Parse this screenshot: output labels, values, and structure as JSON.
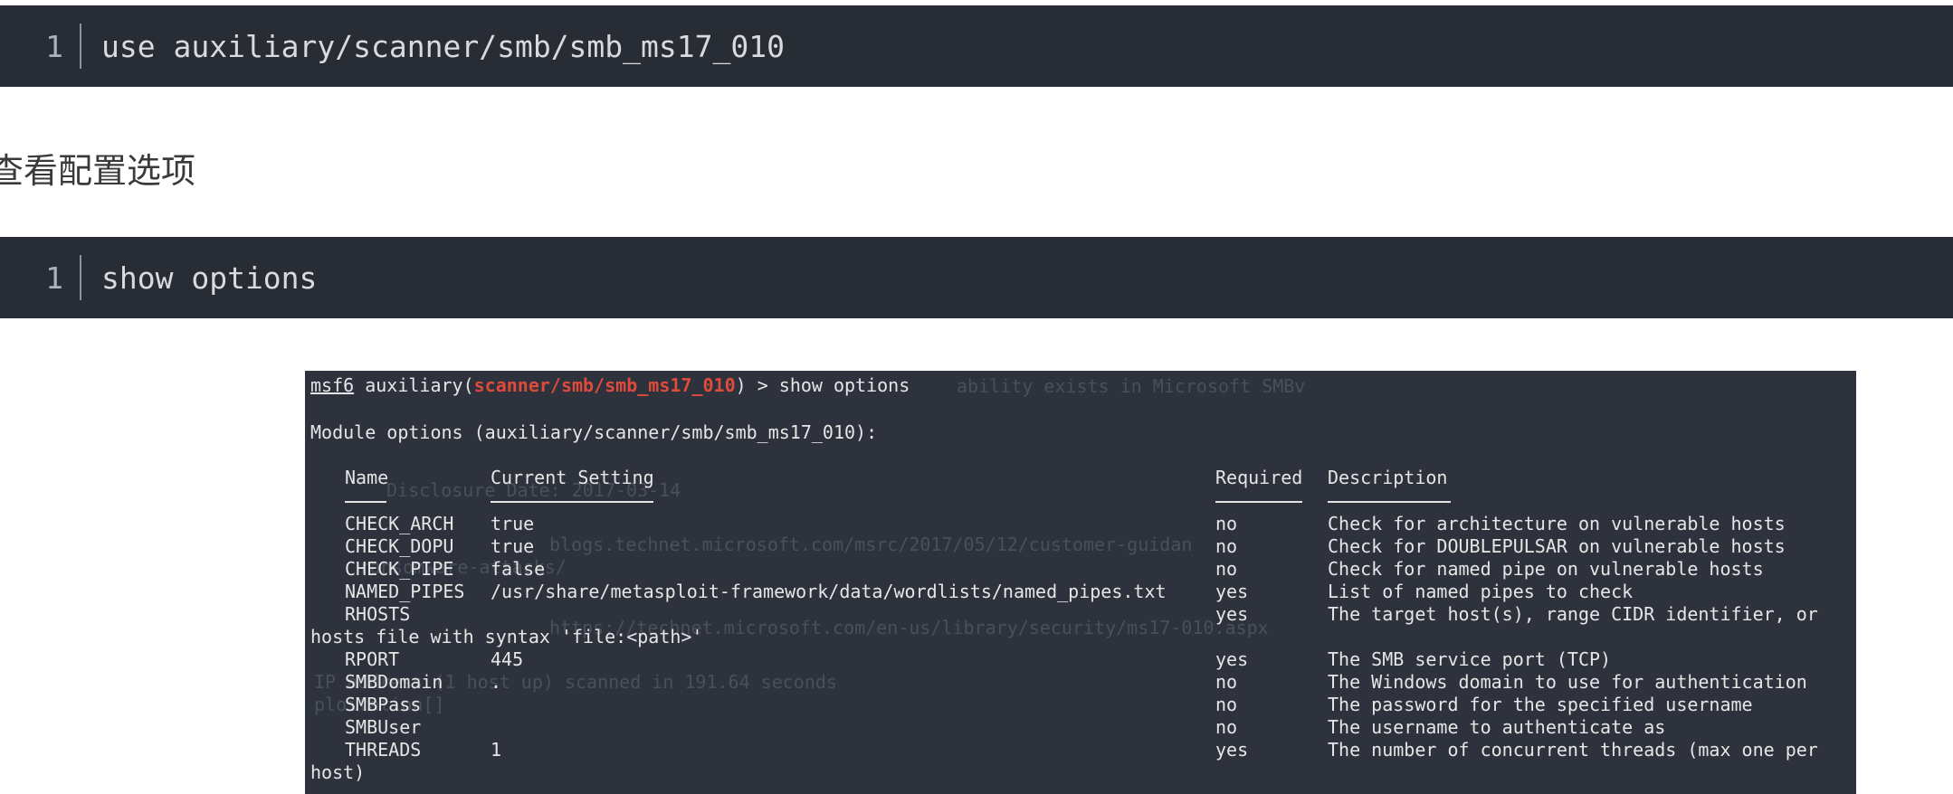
{
  "code1": {
    "line_no": "1",
    "code": "use auxiliary/scanner/smb/smb_ms17_010"
  },
  "para": "查看配置选项",
  "code2": {
    "line_no": "1",
    "code": "show options"
  },
  "terminal": {
    "prompt_user": "msf6",
    "prompt_mid": " auxiliary(",
    "prompt_module": "scanner/smb/smb_ms17_010",
    "prompt_end": ") > show options",
    "module_title": "Module options (auxiliary/scanner/smb/smb_ms17_010):",
    "headers": {
      "name": "Name",
      "setting": "Current Setting",
      "required": "Required",
      "description": "Description"
    },
    "rows": [
      {
        "name": "CHECK_ARCH",
        "setting": "true",
        "required": "no",
        "description": "Check for architecture on vulnerable hosts"
      },
      {
        "name": "CHECK_DOPU",
        "setting": "true",
        "required": "no",
        "description": "Check for DOUBLEPULSAR on vulnerable hosts"
      },
      {
        "name": "CHECK_PIPE",
        "setting": "false",
        "required": "no",
        "description": "Check for named pipe on vulnerable hosts"
      },
      {
        "name": "NAMED_PIPES",
        "setting": "/usr/share/metasploit-framework/data/wordlists/named_pipes.txt",
        "required": "yes",
        "description": "List of named pipes to check"
      },
      {
        "name": "RHOSTS",
        "setting": "",
        "required": "yes",
        "description": "The target host(s), range CIDR identifier, or"
      },
      {
        "name": "RPORT",
        "setting": "445",
        "required": "yes",
        "description": "The SMB service port (TCP)"
      },
      {
        "name": "SMBDomain",
        "setting": ".",
        "required": "no",
        "description": "The Windows domain to use for authentication"
      },
      {
        "name": "SMBPass",
        "setting": "",
        "required": "no",
        "description": "The password for the specified username"
      },
      {
        "name": "SMBUser",
        "setting": "",
        "required": "no",
        "description": "The username to authenticate as"
      },
      {
        "name": "THREADS",
        "setting": "1",
        "required": "yes",
        "description": "The number of concurrent threads (max one per"
      }
    ],
    "rhosts_wrap": "hosts file with syntax 'file:<path>'",
    "threads_wrap": "host)",
    "ghost_lines": [
      "ability exists in Microsoft SMBv",
      "Disclosure Date: 2017-03-14",
      "blogs.technet.microsoft.com/msrc/2017/05/12/customer-guidan",
      "ransomware-attacks/",
      "https://technet.microsoft.com/en-us/library/security/ms17-010.aspx",
      "IP address (1 host up) scanned in 191.64 seconds",
      "ploitation[]"
    ]
  }
}
